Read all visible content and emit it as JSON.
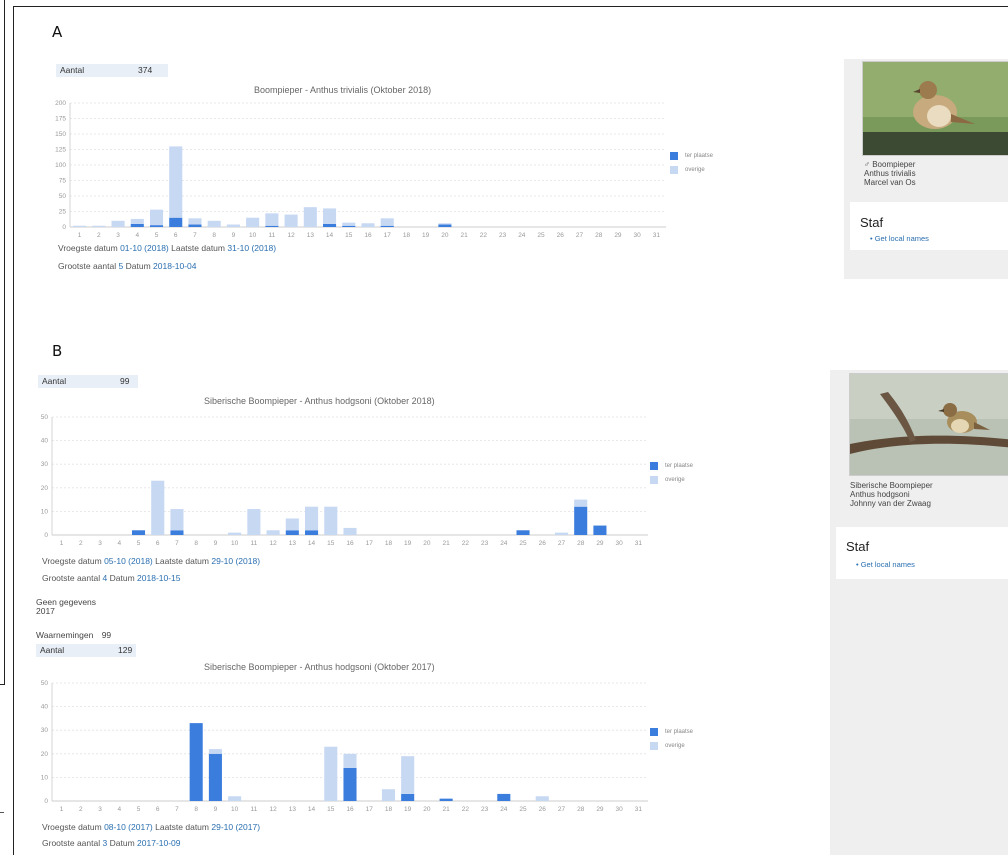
{
  "colors": {
    "accent": "#3b7ddd",
    "light": "#c7d8f3",
    "link": "#2a6fb0"
  },
  "days": [
    "1",
    "2",
    "3",
    "4",
    "5",
    "6",
    "7",
    "8",
    "9",
    "10",
    "11",
    "12",
    "13",
    "14",
    "15",
    "16",
    "17",
    "18",
    "19",
    "20",
    "21",
    "22",
    "23",
    "24",
    "25",
    "26",
    "27",
    "28",
    "29",
    "30",
    "31"
  ],
  "common": {
    "vroegste_label": "Vroegste datum",
    "laatste_label": "Laatste datum",
    "grootste_label": "Grootste aantal",
    "datum_label": "Datum",
    "staf_title": "Staf",
    "staf_link": "Get local names",
    "aantal_label": "Aantal"
  },
  "panel_a": {
    "label": "A",
    "aantal": "374",
    "title": "Boompieper - Anthus trivialis (Oktober 2018)",
    "vroegste": "01-10 (2018)",
    "laatste": "31-10 (2018)",
    "grootste_value": "5",
    "grootste_date": "2018-10-04",
    "caption": [
      "♂ Boompieper",
      "Anthus trivialis",
      "Marcel van Os"
    ],
    "legend": [
      "ter plaatse",
      "overige"
    ]
  },
  "panel_b": {
    "label": "B",
    "aantal": "99",
    "title": "Siberische Boompieper - Anthus hodgsoni (Oktober 2018)",
    "vroegste": "05-10 (2018)",
    "laatste": "29-10 (2018)",
    "grootste_value": "4",
    "grootste_date": "2018-10-15",
    "caption": [
      "Siberische Boompieper",
      "Anthus hodgsoni",
      "Johnny van der Zwaag"
    ],
    "legend": [
      "ter plaatse",
      "overige"
    ],
    "no_data": "Geen gegevens",
    "year": "2017",
    "waarnemingen_label": "Waarnemingen",
    "waarnemingen": "99",
    "aantal2": "129",
    "title2": "Siberische Boompieper - Anthus hodgsoni (Oktober 2017)",
    "vroegste2": "08-10 (2017)",
    "laatste2": "29-10 (2017)",
    "grootste_value2": "3",
    "grootste_date2": "2017-10-09"
  },
  "chart_data": [
    {
      "type": "bar",
      "title": "Boompieper - Anthus trivialis (Oktober 2018)",
      "categories": [
        "1",
        "2",
        "3",
        "4",
        "5",
        "6",
        "7",
        "8",
        "9",
        "10",
        "11",
        "12",
        "13",
        "14",
        "15",
        "16",
        "17",
        "18",
        "19",
        "20",
        "21",
        "22",
        "23",
        "24",
        "25",
        "26",
        "27",
        "28",
        "29",
        "30",
        "31"
      ],
      "ylim": [
        0,
        200
      ],
      "yticks": [
        0,
        25,
        50,
        75,
        100,
        125,
        150,
        175,
        200
      ],
      "stacked": true,
      "series": [
        {
          "name": "ter plaatse",
          "values": [
            0,
            0,
            0,
            5,
            3,
            15,
            4,
            0,
            0,
            0,
            2,
            0,
            0,
            5,
            2,
            0,
            2,
            0,
            0,
            4,
            0,
            0,
            0,
            0,
            0,
            0,
            0,
            0,
            0,
            0,
            0
          ]
        },
        {
          "name": "overige",
          "values": [
            2,
            2,
            10,
            8,
            25,
            115,
            10,
            10,
            4,
            15,
            20,
            20,
            32,
            25,
            5,
            6,
            12,
            0,
            0,
            2,
            0,
            0,
            0,
            0,
            0,
            0,
            0,
            0,
            0,
            0,
            0
          ]
        }
      ]
    },
    {
      "type": "bar",
      "title": "Siberische Boompieper - Anthus hodgsoni (Oktober 2018)",
      "categories": [
        "1",
        "2",
        "3",
        "4",
        "5",
        "6",
        "7",
        "8",
        "9",
        "10",
        "11",
        "12",
        "13",
        "14",
        "15",
        "16",
        "17",
        "18",
        "19",
        "20",
        "21",
        "22",
        "23",
        "24",
        "25",
        "26",
        "27",
        "28",
        "29",
        "30",
        "31"
      ],
      "ylim": [
        0,
        50
      ],
      "yticks": [
        0,
        10,
        20,
        30,
        40,
        50
      ],
      "stacked": true,
      "series": [
        {
          "name": "ter plaatse",
          "values": [
            0,
            0,
            0,
            0,
            2,
            0,
            2,
            0,
            0,
            0,
            0,
            0,
            2,
            2,
            0,
            0,
            0,
            0,
            0,
            0,
            0,
            0,
            0,
            0,
            2,
            0,
            0,
            12,
            4,
            0,
            0
          ]
        },
        {
          "name": "overige",
          "values": [
            0,
            0,
            0,
            0,
            0,
            23,
            9,
            0,
            0,
            1,
            11,
            2,
            5,
            10,
            12,
            3,
            0,
            0,
            0,
            0,
            0,
            0,
            0,
            0,
            0,
            0,
            1,
            3,
            0,
            0,
            0
          ]
        }
      ]
    },
    {
      "type": "bar",
      "title": "Siberische Boompieper - Anthus hodgsoni (Oktober 2017)",
      "categories": [
        "1",
        "2",
        "3",
        "4",
        "5",
        "6",
        "7",
        "8",
        "9",
        "10",
        "11",
        "12",
        "13",
        "14",
        "15",
        "16",
        "17",
        "18",
        "19",
        "20",
        "21",
        "22",
        "23",
        "24",
        "25",
        "26",
        "27",
        "28",
        "29",
        "30",
        "31"
      ],
      "ylim": [
        0,
        50
      ],
      "yticks": [
        0,
        10,
        20,
        30,
        40,
        50
      ],
      "stacked": true,
      "series": [
        {
          "name": "ter plaatse",
          "values": [
            0,
            0,
            0,
            0,
            0,
            0,
            0,
            33,
            20,
            0,
            0,
            0,
            0,
            0,
            0,
            14,
            0,
            0,
            3,
            0,
            1,
            0,
            0,
            3,
            0,
            0,
            0,
            0,
            0,
            0,
            0
          ]
        },
        {
          "name": "overige",
          "values": [
            0,
            0,
            0,
            0,
            0,
            0,
            0,
            0,
            2,
            2,
            0,
            0,
            0,
            0,
            23,
            6,
            0,
            5,
            16,
            0,
            0,
            0,
            0,
            0,
            0,
            2,
            0,
            0,
            0,
            0,
            0
          ]
        }
      ]
    }
  ]
}
